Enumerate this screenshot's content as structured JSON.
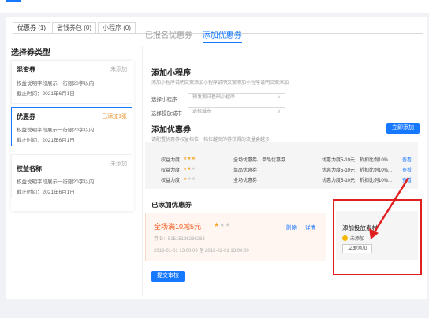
{
  "tabs": [
    {
      "label": "优惠券 (1)",
      "active": true
    },
    {
      "label": "省钱券包 (0)",
      "active": false
    },
    {
      "label": "小程序 (0)",
      "active": false
    }
  ],
  "left": {
    "title": "选择券类型",
    "cards": [
      {
        "name": "混资券",
        "status": "未添加",
        "line1": "权益说明字段展示一行限20字以内",
        "line2": "截止时间：2021年6月1日",
        "selected": false
      },
      {
        "name": "优惠券",
        "status": "已添加1张",
        "line1": "权益说明字段展示一行限20字以内",
        "line2": "截止时间：2021年6月1日",
        "selected": true
      },
      {
        "name": "权益名称",
        "status": "未添加",
        "line1": "权益说明字段展示一行限20字以内",
        "line2": "截止时间：2021年6月1日",
        "selected": false
      }
    ]
  },
  "right": {
    "sub_tabs": [
      "已报名优惠券",
      "添加优惠券"
    ],
    "mini": {
      "title": "添加小程序",
      "desc": "添加小程序说明文案添加小程序说明文案添加小程序说明文案添加",
      "label_program": "选择小程序",
      "select_program": "预发测试基础小程序",
      "label_city": "选择投放城市",
      "select_city": "选择城市"
    },
    "coupon": {
      "title": "添加优惠券",
      "desc": "请配置优惠券权益档位，档位越高的券获得的流量会越多",
      "add_button": "立即添加"
    },
    "priority_rows": [
      {
        "label": "权益力度",
        "stars": 3,
        "scope": "全场优惠券、单品优惠券",
        "range": "优惠力度5-10元，折扣比例10%...",
        "link": "查看"
      },
      {
        "label": "权益力度",
        "stars": 2,
        "scope": "单品优惠券",
        "range": "优惠力度5-10元，折扣比例10%...",
        "link": "查看"
      },
      {
        "label": "权益力度",
        "stars": 1,
        "scope": "全场优惠券",
        "range": "优惠力度5-10元，折扣比例10%...",
        "link": "查看"
      }
    ],
    "added": {
      "title": "已添加优惠券",
      "coupon_title": "全场满10减5元",
      "stars": 1,
      "delete": "删除",
      "detail": "详情",
      "coupon_id": "券ID：51515136236263",
      "time": "2019-01-01 13:00:00 至 2019-02-01 13:00:00"
    },
    "material": {
      "title": "添加投放素材",
      "status": "未添加",
      "button": "立即添加"
    },
    "submit": "提交审核"
  },
  "colors": {
    "accent": "#1677ff",
    "orange": "#e8912c",
    "coupon_red": "#f05a1e",
    "annotation": "#e02020"
  }
}
